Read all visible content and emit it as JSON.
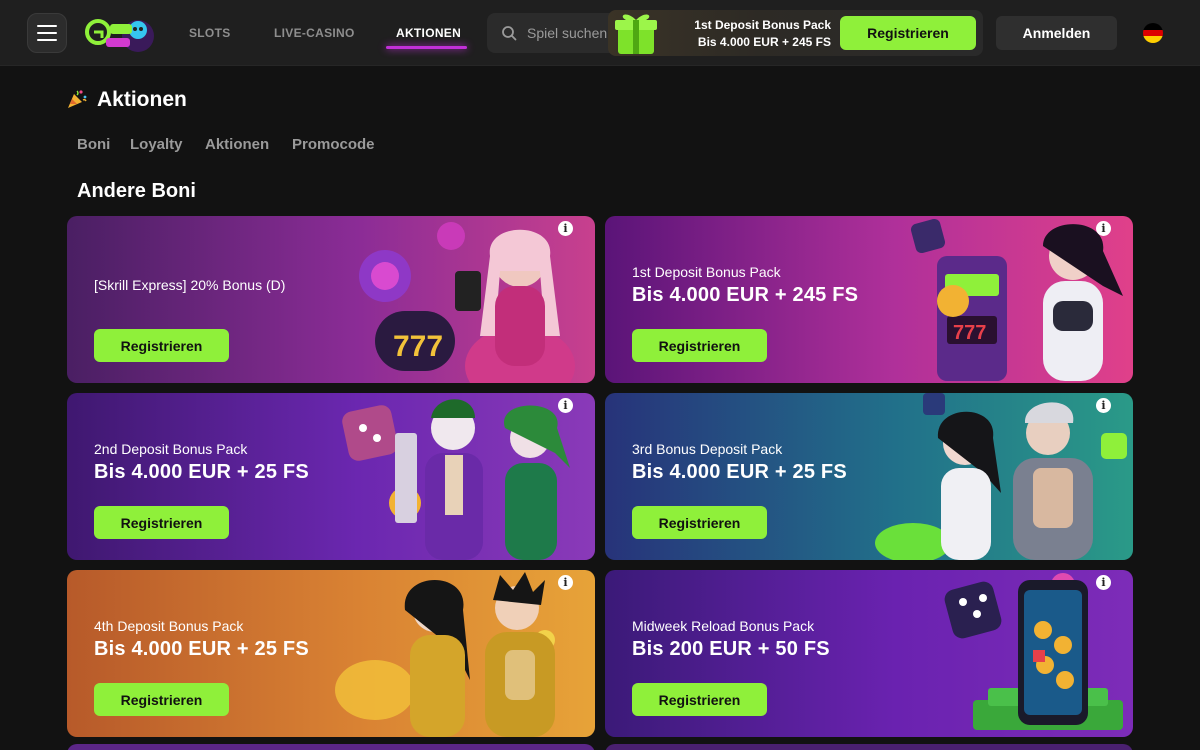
{
  "header": {
    "nav": [
      "SLOTS",
      "LIVE-CASINO",
      "AKTIONEN"
    ],
    "search_placeholder": "Spiel suchen",
    "promo_title": "1st Deposit Bonus Pack",
    "promo_amount": "Bis 4.000 EUR + 245 FS",
    "register_label": "Registrieren",
    "login_label": "Anmelden",
    "language_flag": "germany-flag-icon",
    "accent_color": "#8ff03a",
    "active_nav_color": "#c230d8"
  },
  "page": {
    "title": "Aktionen",
    "title_icon": "party-popper-icon",
    "tabs": [
      "Boni",
      "Loyalty",
      "Aktionen",
      "Promocode"
    ],
    "section_title": "Andere Boni"
  },
  "cards": [
    {
      "subtitle": "[Skrill Express] 20% Bonus (D)",
      "headline": "",
      "button": "Registrieren"
    },
    {
      "subtitle": "1st Deposit Bonus Pack",
      "headline": "Bis 4.000 EUR + 245 FS",
      "button": "Registrieren"
    },
    {
      "subtitle": "2nd Deposit Bonus Pack",
      "headline": "Bis 4.000 EUR + 25 FS",
      "button": "Registrieren"
    },
    {
      "subtitle": "3rd Bonus Deposit Pack",
      "headline": "Bis 4.000 EUR + 25 FS",
      "button": "Registrieren"
    },
    {
      "subtitle": "4th Deposit Bonus Pack",
      "headline": "Bis 4.000 EUR + 25 FS",
      "button": "Registrieren"
    },
    {
      "subtitle": "Midweek Reload Bonus Pack",
      "headline": "Bis 200 EUR + 50 FS",
      "button": "Registrieren"
    }
  ]
}
